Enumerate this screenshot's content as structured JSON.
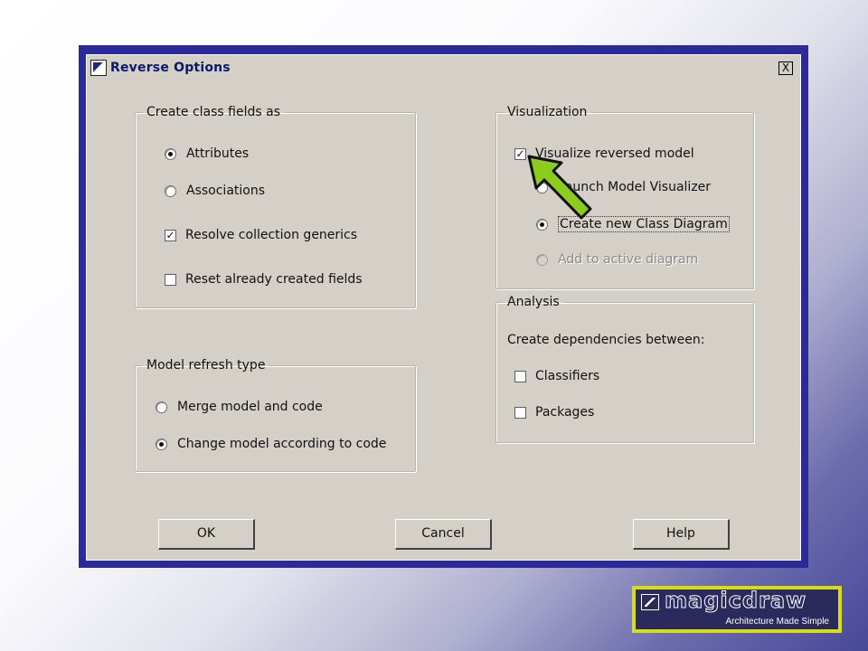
{
  "dialog": {
    "title": "Reverse Options",
    "close_label": "X"
  },
  "class_fields": {
    "legend": "Create class fields as",
    "attributes": "Attributes",
    "associations": "Associations",
    "resolve_generics": "Resolve collection generics",
    "reset_fields": "Reset already created fields"
  },
  "refresh": {
    "legend": "Model refresh type",
    "merge": "Merge model and code",
    "change": "Change model according to code"
  },
  "visualization": {
    "legend": "Visualization",
    "visualize": "Visualize reversed model",
    "launch": "Launch Model Visualizer",
    "create_new": "Create new Class Diagram",
    "add_active": "Add to active diagram"
  },
  "analysis": {
    "legend": "Analysis",
    "create_deps": "Create dependencies between:",
    "classifiers": "Classifiers",
    "packages": "Packages"
  },
  "buttons": {
    "ok": "OK",
    "cancel": "Cancel",
    "help": "Help"
  },
  "state": {
    "class_field_mode": "Attributes",
    "resolve_generics_checked": true,
    "reset_fields_checked": false,
    "refresh_mode": "Change model according to code",
    "visualize_checked": true,
    "visualizer_mode": "Create new Class Diagram",
    "classifiers_checked": false,
    "packages_checked": false
  },
  "icons": {
    "pointer": "green-arrow-pointer-icon",
    "app": "magicdraw-app-icon"
  },
  "colors": {
    "title_border": "#2b2a99",
    "dialog_bg": "#d4d0c8",
    "arrow": "#8ccc1c",
    "logo_frame": "#d6dd12"
  },
  "logo": {
    "brand": "magicdraw",
    "tagline": "Architecture Made Simple"
  }
}
